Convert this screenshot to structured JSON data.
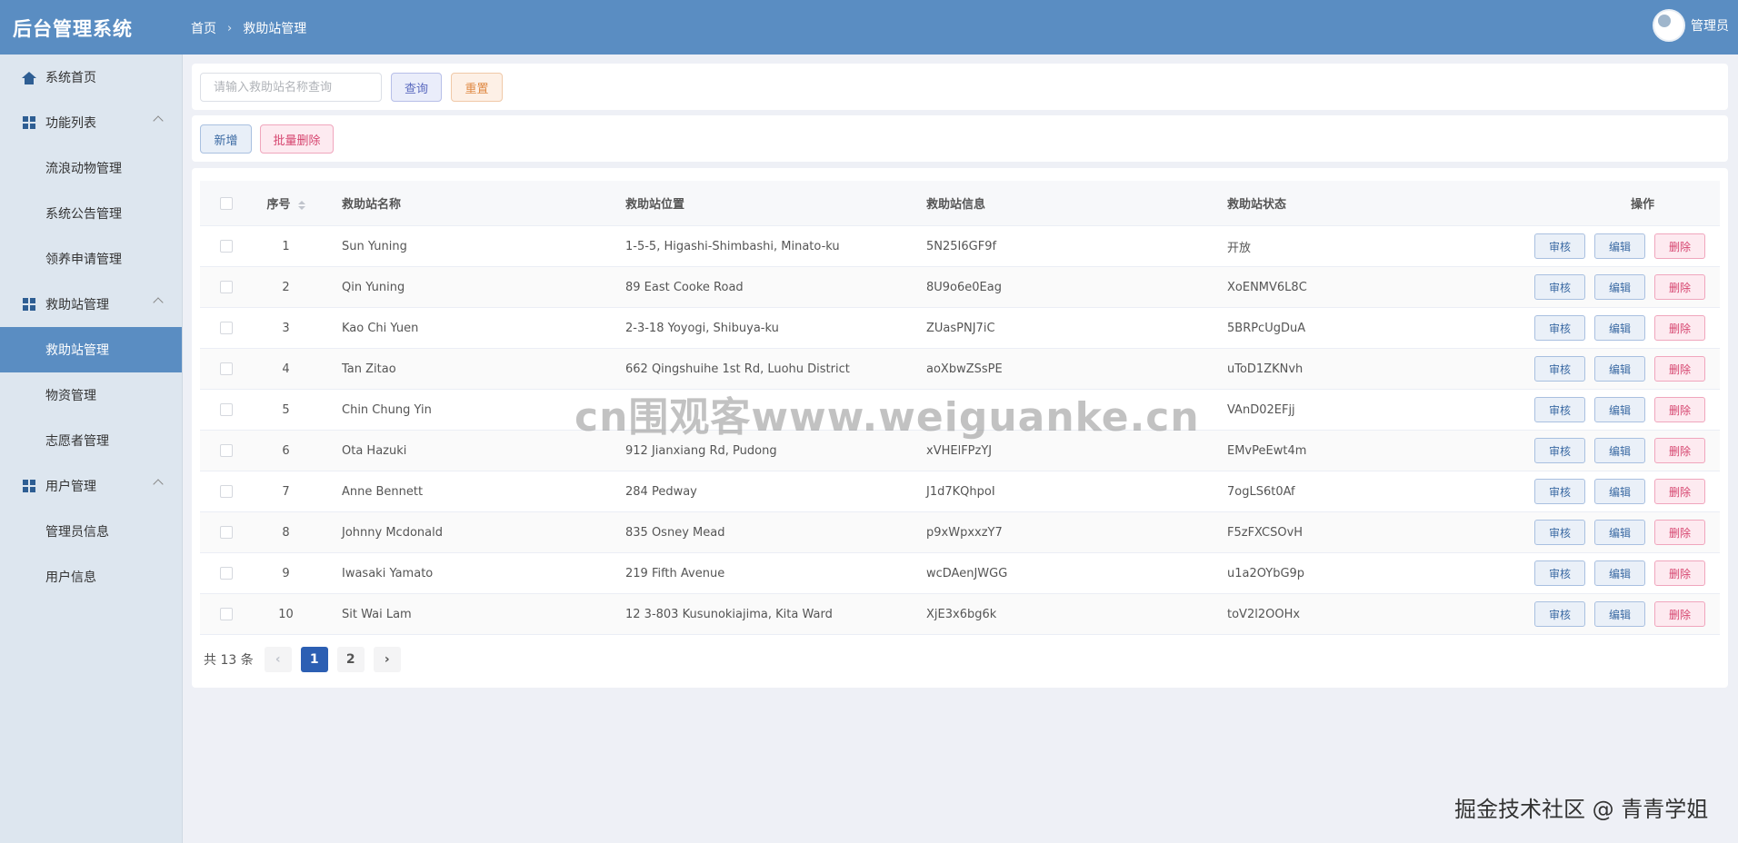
{
  "app": {
    "title": "后台管理系统"
  },
  "header": {
    "breadcrumb": [
      "首页",
      "救助站管理"
    ],
    "user_name": "管理员"
  },
  "sidebar": {
    "items": [
      {
        "label": "系统首页",
        "icon": "home-icon"
      },
      {
        "label": "功能列表",
        "icon": "grid-icon",
        "expanded": true,
        "children": [
          "流浪动物管理",
          "系统公告管理",
          "领养申请管理"
        ]
      },
      {
        "label": "救助站管理",
        "icon": "grid-icon",
        "expanded": true,
        "children": [
          "救助站管理",
          "物资管理",
          "志愿者管理"
        ]
      },
      {
        "label": "用户管理",
        "icon": "grid-icon",
        "expanded": true,
        "children": [
          "管理员信息",
          "用户信息"
        ]
      }
    ],
    "active_item": "救助站管理"
  },
  "search": {
    "placeholder": "请输入救助站名称查询",
    "value": "",
    "query_label": "查询",
    "reset_label": "重置"
  },
  "actions": {
    "add_label": "新增",
    "batch_delete_label": "批量删除"
  },
  "table": {
    "columns": [
      "序号",
      "救助站名称",
      "救助站位置",
      "救助站信息",
      "救助站状态",
      "操作"
    ],
    "op_labels": {
      "audit": "审核",
      "edit": "编辑",
      "delete": "删除"
    },
    "rows": [
      {
        "no": "1",
        "name": "Sun Yuning",
        "location": "1-5-5, Higashi-Shimbashi, Minato-ku",
        "info": "5N25I6GF9f",
        "status": "开放"
      },
      {
        "no": "2",
        "name": "Qin Yuning",
        "location": "89 East Cooke Road",
        "info": "8U9o6e0Eag",
        "status": "XoENMV6L8C"
      },
      {
        "no": "3",
        "name": "Kao Chi Yuen",
        "location": "2-3-18 Yoyogi, Shibuya-ku",
        "info": "ZUasPNJ7iC",
        "status": "5BRPcUgDuA"
      },
      {
        "no": "4",
        "name": "Tan Zitao",
        "location": "662 Qingshuihe 1st Rd, Luohu District",
        "info": "aoXbwZSsPE",
        "status": "uToD1ZKNvh"
      },
      {
        "no": "5",
        "name": "Chin Chung Yin",
        "location": "",
        "info": "",
        "status": "VAnD02EFjj"
      },
      {
        "no": "6",
        "name": "Ota Hazuki",
        "location": "912 Jianxiang Rd, Pudong",
        "info": "xVHElFPzYJ",
        "status": "EMvPeEwt4m"
      },
      {
        "no": "7",
        "name": "Anne Bennett",
        "location": "284 Pedway",
        "info": "J1d7KQhpoI",
        "status": "7ogLS6t0Af"
      },
      {
        "no": "8",
        "name": "Johnny Mcdonald",
        "location": "835 Osney Mead",
        "info": "p9xWpxxzY7",
        "status": "F5zFXCSOvH"
      },
      {
        "no": "9",
        "name": "Iwasaki Yamato",
        "location": "219 Fifth Avenue",
        "info": "wcDAenJWGG",
        "status": "u1a2OYbG9p"
      },
      {
        "no": "10",
        "name": "Sit Wai Lam",
        "location": "12 3-803 Kusunokiajima, Kita Ward",
        "info": "XjE3x6bg6k",
        "status": "toV2l2OOHx"
      }
    ]
  },
  "pagination": {
    "total_text": "共 13 条",
    "pages": [
      "1",
      "2"
    ],
    "current": "1",
    "prev_icon": "chevron-left-icon",
    "next_icon": "chevron-right-icon"
  },
  "watermarks": {
    "center": "cn围观客www.weiguanke.cn",
    "corner": "掘金技术社区 @ 青青学姐"
  },
  "colors": {
    "header": "#5a8dc2",
    "sidebar": "#dde6ef",
    "active_menu": "#5a8dc2",
    "page_active": "#2c5fb3",
    "danger": "#d6456f"
  }
}
